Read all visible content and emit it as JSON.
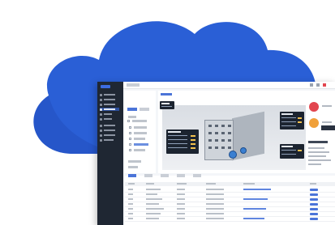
{
  "illustration": {
    "cloud_color": "#2a5fd6",
    "cloud_shade": "#1f49b3",
    "background": "#ffffff"
  },
  "app": {
    "sidebar_color": "#1f2733",
    "accent": "#4b74d8",
    "alert_colors": [
      "#e2454f",
      "#f0a03a"
    ],
    "building_icon": "building-3d-model",
    "fan_icon": "ventilation-fan"
  }
}
